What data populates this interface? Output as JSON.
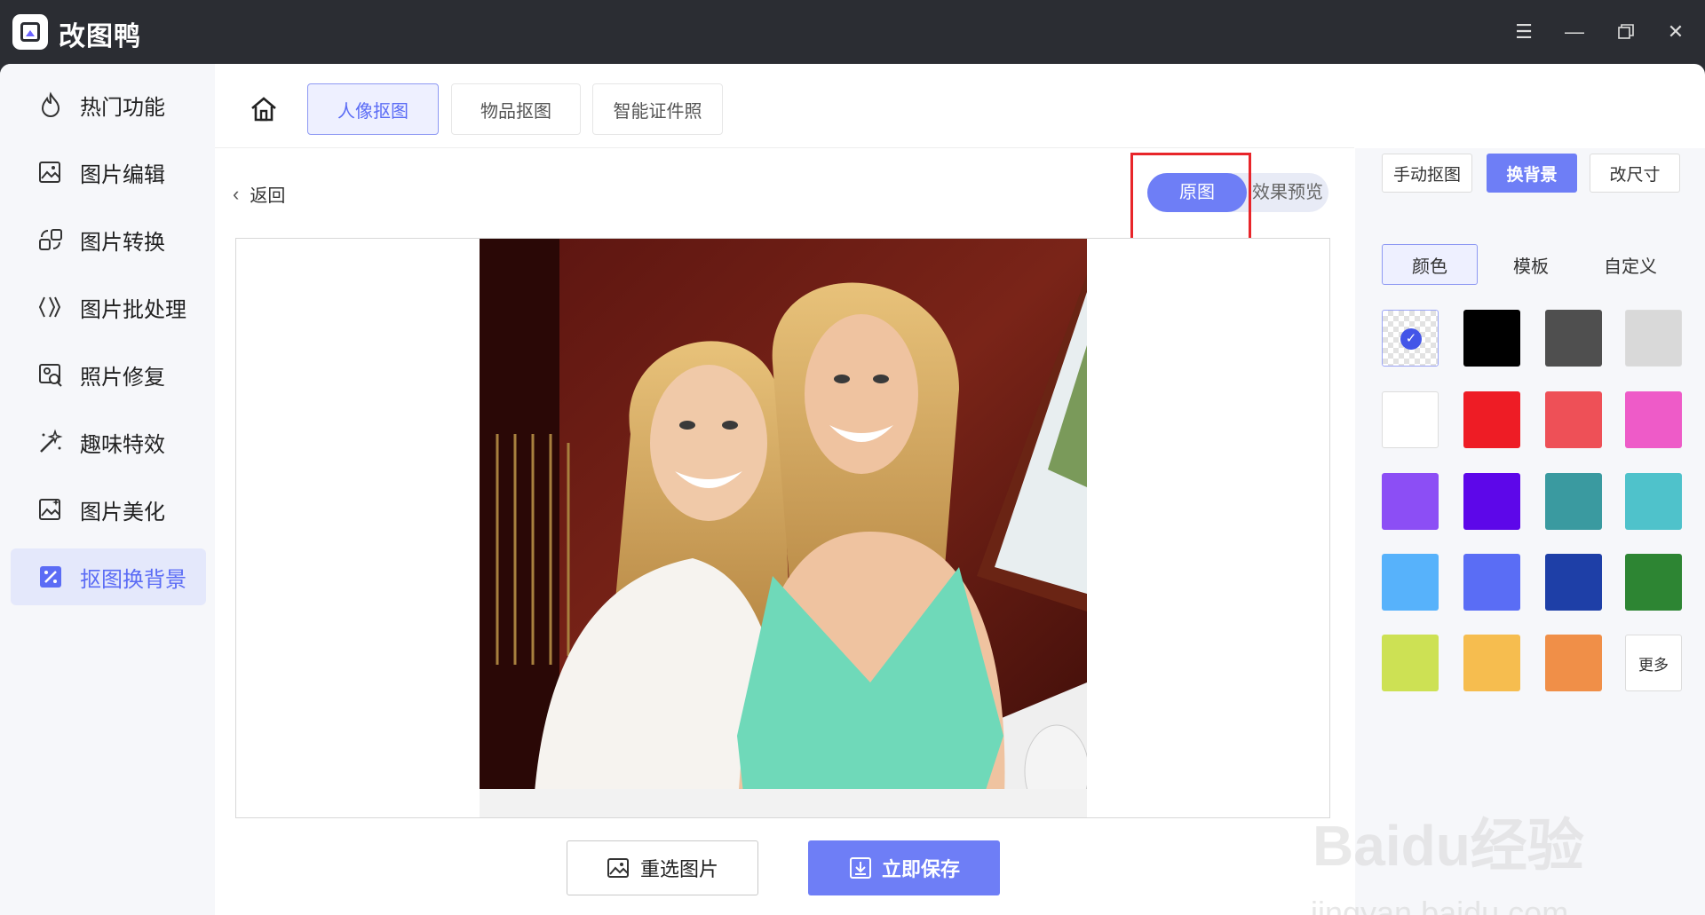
{
  "app": {
    "title": "改图鸭"
  },
  "sidebar": {
    "items": [
      {
        "label": "热门功能",
        "icon": "fire-icon"
      },
      {
        "label": "图片编辑",
        "icon": "image-edit-icon"
      },
      {
        "label": "图片转换",
        "icon": "convert-icon"
      },
      {
        "label": "图片批处理",
        "icon": "batch-icon"
      },
      {
        "label": "照片修复",
        "icon": "repair-icon"
      },
      {
        "label": "趣味特效",
        "icon": "magic-wand-icon"
      },
      {
        "label": "图片美化",
        "icon": "beautify-icon"
      },
      {
        "label": "抠图换背景",
        "icon": "cutout-icon",
        "active": true
      }
    ]
  },
  "tabs": [
    {
      "label": "人像抠图",
      "active": true
    },
    {
      "label": "物品抠图"
    },
    {
      "label": "智能证件照"
    }
  ],
  "workspace": {
    "back_label": "返回",
    "toggle": {
      "original": "原图",
      "preview": "效果预览",
      "selected": "原图"
    },
    "reselect_label": "重选图片",
    "save_label": "立即保存"
  },
  "right_panel": {
    "actions": [
      {
        "label": "手动抠图"
      },
      {
        "label": "换背景",
        "active": true
      },
      {
        "label": "改尺寸"
      }
    ],
    "subtabs": [
      {
        "label": "颜色",
        "active": true
      },
      {
        "label": "模板"
      },
      {
        "label": "自定义"
      }
    ],
    "swatches": [
      {
        "color": "transparent",
        "selected": true
      },
      {
        "color": "#000000"
      },
      {
        "color": "#4f4f4f"
      },
      {
        "color": "#d9d9d9"
      },
      {
        "color": "#ffffff"
      },
      {
        "color": "#ee1c25"
      },
      {
        "color": "#ee5057"
      },
      {
        "color": "#ee5bc8"
      },
      {
        "color": "#8c4ef5"
      },
      {
        "color": "#5d07e9"
      },
      {
        "color": "#3a9aa0"
      },
      {
        "color": "#4fc2cb"
      },
      {
        "color": "#57b2fb"
      },
      {
        "color": "#5a6df5"
      },
      {
        "color": "#1e3fa7"
      },
      {
        "color": "#2d8533"
      },
      {
        "color": "#cde154"
      },
      {
        "color": "#f6bd4f"
      },
      {
        "color": "#f08f48"
      }
    ],
    "more_label": "更多"
  },
  "watermark": {
    "main": "Baidu经验",
    "sub": "jingyan.baidu.com"
  },
  "colors": {
    "accent": "#6e7ef6",
    "highlight": "#e8252a",
    "titlebar": "#2b2d33"
  }
}
